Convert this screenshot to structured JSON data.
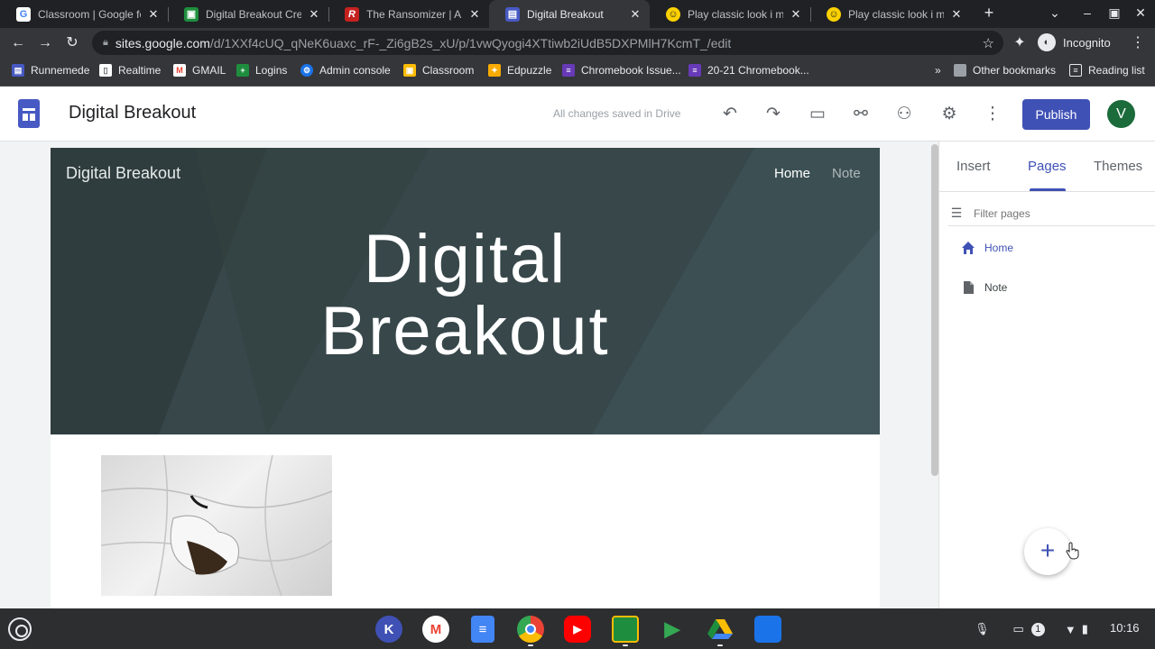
{
  "browser": {
    "tabs": [
      {
        "title": "Classroom | Google for",
        "favicon": "google-icon",
        "color": "#ffffff"
      },
      {
        "title": "Digital Breakout Creatio",
        "favicon": "classroom-icon",
        "color": "#1e8e3e"
      },
      {
        "title": "The Ransomizer | A ran",
        "favicon": "ransomizer-icon",
        "color": "#c5221f"
      },
      {
        "title": "Digital Breakout",
        "favicon": "sites-icon",
        "color": "#4759c3"
      },
      {
        "title": "Play classic look i m a",
        "favicon": "smiley-icon",
        "color": "#fbd100"
      },
      {
        "title": "Play classic look i m a",
        "favicon": "smiley-icon",
        "color": "#fbd100"
      }
    ],
    "active_tab": 3,
    "new_tab_glyph": "+",
    "url_host": "sites.google.com",
    "url_path": "/d/1XXf4cUQ_qNeK6uaxc_rF-_Zi6gB2s_xU/p/1vwQyogi4XTtiwb2iUdB5DXPMlH7KcmT_/edit",
    "incognito_label": "Incognito",
    "bookmarks": [
      {
        "label": "Runnemede",
        "icon": "sites-icon",
        "color": "#4759c3"
      },
      {
        "label": "Realtime",
        "icon": "page-icon",
        "color": "#ffffff"
      },
      {
        "label": "GMAIL",
        "icon": "gmail-icon",
        "color": "#ea4335"
      },
      {
        "label": "Logins",
        "icon": "sheets-icon",
        "color": "#1e8e3e"
      },
      {
        "label": "Admin console",
        "icon": "admin-icon",
        "color": "#1a73e8"
      },
      {
        "label": "Classroom",
        "icon": "classroom-icon",
        "color": "#fbbc04"
      },
      {
        "label": "Edpuzzle",
        "icon": "edpuzzle-icon",
        "color": "#f9ab00"
      },
      {
        "label": "Chromebook Issue...",
        "icon": "forms-icon",
        "color": "#673ab7"
      },
      {
        "label": "20-21 Chromebook...",
        "icon": "forms-icon",
        "color": "#673ab7"
      }
    ],
    "more_bookmarks_glyph": "»",
    "other_bookmarks": "Other bookmarks",
    "reading_list": "Reading list"
  },
  "sites": {
    "doc_title": "Digital Breakout",
    "save_status": "All changes saved in Drive",
    "publish_label": "Publish",
    "avatar_letter": "V",
    "accent": "#3f51b5"
  },
  "site": {
    "name": "Digital Breakout",
    "nav": [
      "Home",
      "Note"
    ],
    "hero_line1": "Digital",
    "hero_line2": "Breakout",
    "hero_color": "#37474a"
  },
  "panel": {
    "tabs": [
      "Insert",
      "Pages",
      "Themes"
    ],
    "active_tab": 1,
    "filter_placeholder": "Filter pages",
    "pages": [
      {
        "label": "Home",
        "icon": "home-icon",
        "selected": true
      },
      {
        "label": "Note",
        "icon": "page-icon",
        "selected": false
      }
    ],
    "fab_glyph": "+"
  },
  "shelf": {
    "apps": [
      {
        "name": "kami-icon",
        "letter": "K",
        "color": "#3f51b5"
      },
      {
        "name": "gmail-icon",
        "letter": "M",
        "color": "#ffffff"
      },
      {
        "name": "docs-icon",
        "letter": "≡",
        "color": "#4285f4"
      },
      {
        "name": "chrome-icon",
        "letter": "",
        "color": "#ea4335"
      },
      {
        "name": "youtube-icon",
        "letter": "▶",
        "color": "#ff0000"
      },
      {
        "name": "classroom-icon",
        "letter": "",
        "color": "#1e8e3e"
      },
      {
        "name": "play-store-icon",
        "letter": "▶",
        "color": "#ffffff"
      },
      {
        "name": "drive-icon",
        "letter": "",
        "color": "#ffffff"
      },
      {
        "name": "files-icon",
        "letter": "",
        "color": "#1a73e8"
      }
    ],
    "notification_count": "1",
    "time": "10:16"
  }
}
